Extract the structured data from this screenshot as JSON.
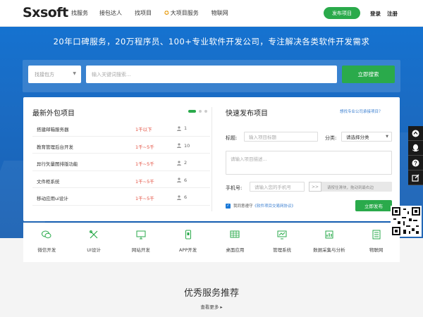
{
  "header": {
    "logo_text": "Sxsoft",
    "nav": [
      {
        "label": "找服务"
      },
      {
        "label": "接包达人"
      },
      {
        "label": "找项目"
      },
      {
        "label": "大项目服务"
      },
      {
        "label": "物联网"
      }
    ],
    "publish_label": "发布项目",
    "login_label": "登录",
    "register_label": "注册"
  },
  "hero": {
    "title": "20年口碑服务，20万程序员、100+专业软件开发公司，专注解决各类软件开发需求",
    "search": {
      "select_value": "找接包方",
      "placeholder": "输入关键词搜索...",
      "button_label": "立即搜索"
    }
  },
  "latest": {
    "title": "最新外包项目",
    "items": [
      {
        "name": "搭建邮箱服务器",
        "price": "1千以下",
        "count": "1"
      },
      {
        "name": "教育管理后台开发",
        "price": "1千~5千",
        "count": "10"
      },
      {
        "name": "异行矢量图排版功能",
        "price": "1千~5千",
        "count": "2"
      },
      {
        "name": "文件柜系统",
        "price": "1千~5千",
        "count": "6"
      },
      {
        "name": "移动应用ui设计",
        "price": "1千~5千",
        "count": "6"
      }
    ]
  },
  "quick_publish": {
    "title": "快速发布项目",
    "help_link": "想找专业公司承接项目？",
    "title_label": "标题:",
    "title_placeholder": "输入项目标题",
    "category_label": "分类:",
    "category_value": "请选择分类",
    "desc_placeholder": "请输入项目描述...",
    "phone_label": "手机号:",
    "phone_placeholder": "请输入您的手机号",
    "slider_handle": ">>",
    "slider_text": "请按住滑块，拖动到最右边",
    "agree_text": "我同意遵守",
    "agree_link": "《软件项目交易网协议》",
    "submit_label": "立即发布"
  },
  "categories": [
    {
      "label": "微信开发",
      "icon": "wechat-icon"
    },
    {
      "label": "UI设计",
      "icon": "design-icon"
    },
    {
      "label": "网站开发",
      "icon": "monitor-icon"
    },
    {
      "label": "APP开发",
      "icon": "phone-icon"
    },
    {
      "label": "桌面应用",
      "icon": "grid-icon"
    },
    {
      "label": "管理系统",
      "icon": "chart-monitor-icon"
    },
    {
      "label": "数据采集与分析",
      "icon": "database-icon"
    },
    {
      "label": "物联网",
      "icon": "iot-icon"
    }
  ],
  "recommend": {
    "title": "优秀服务推荐",
    "more_label": "查看更多 ▸"
  },
  "side": {
    "buttons": [
      "arrow-up-icon",
      "qq-icon",
      "question-icon",
      "edit-icon"
    ]
  },
  "colors": {
    "primary_blue": "#1b6bc2",
    "accent_green": "#2aaa4b",
    "price_red": "#e34c3c"
  }
}
